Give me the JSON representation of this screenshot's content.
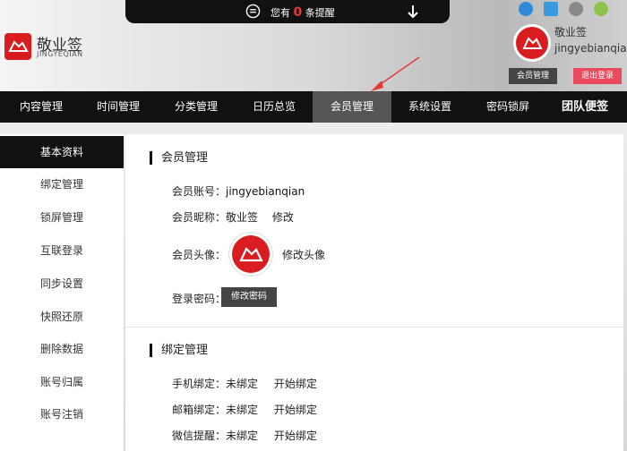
{
  "notice": {
    "prefix": "您有",
    "count": "0",
    "suffix": "条提醒"
  },
  "brand": {
    "name_cn": "敬业签",
    "name_en": "JINGYEQIAN",
    "color": "#d81c1f"
  },
  "user": {
    "nickname": "敬业签",
    "account": "jingyebianqian",
    "member_btn": "会员管理",
    "logout_btn": "退出登录"
  },
  "nav": {
    "items": [
      {
        "label": "内容管理"
      },
      {
        "label": "时间管理"
      },
      {
        "label": "分类管理"
      },
      {
        "label": "日历总览"
      },
      {
        "label": "会员管理"
      },
      {
        "label": "系统设置"
      },
      {
        "label": "密码锁屏"
      },
      {
        "label": "团队便签"
      }
    ]
  },
  "sidebar": {
    "items": [
      {
        "label": "基本资料"
      },
      {
        "label": "绑定管理"
      },
      {
        "label": "锁屏管理"
      },
      {
        "label": "互联登录"
      },
      {
        "label": "同步设置"
      },
      {
        "label": "快照还原"
      },
      {
        "label": "删除数据"
      },
      {
        "label": "账号归属"
      },
      {
        "label": "账号注销"
      }
    ]
  },
  "member": {
    "title": "会员管理",
    "account_label": "会员账号：",
    "account_value": "jingyebianqian",
    "nickname_label": "会员昵称：",
    "nickname_value": "敬业签",
    "nickname_edit": "修改",
    "avatar_label": "会员头像：",
    "avatar_edit": "修改头像",
    "password_label": "登录密码：",
    "password_btn": "修改密码"
  },
  "binding": {
    "title": "绑定管理",
    "rows": [
      {
        "label": "手机绑定：",
        "status": "未绑定",
        "action": "开始绑定"
      },
      {
        "label": "邮箱绑定：",
        "status": "未绑定",
        "action": "开始绑定"
      },
      {
        "label": "微信提醒：",
        "status": "未绑定",
        "action": "开始绑定"
      }
    ]
  }
}
